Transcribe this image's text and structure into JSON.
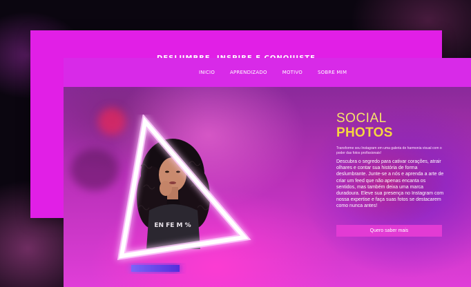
{
  "back_card": {
    "title": "DESLUMBRE, INSPIRE E CONQUISTE"
  },
  "nav": {
    "items": [
      {
        "label": "INICIO"
      },
      {
        "label": "APRENDIZADO"
      },
      {
        "label": "MOTIVO"
      },
      {
        "label": "SOBRE MIM"
      }
    ]
  },
  "hero": {
    "kicker": "SOCIAL",
    "headline": "PHOTOS",
    "small_text": "Transforme seu Instagram em uma galeria de harmonia visual com o poder das fotos profissionais!",
    "body": "Descubra o segredo para cativar corações, atrair olhares e contar sua história de forma deslumbrante. Junte-se a nós e aprenda a arte de criar um feed que não apenas encanta os sentidos, mas também deixa uma marca duradoura. Eleve sua presença no Instagram com nossa expertise e faça suas fotos se destacarem como nunca antes!",
    "cta_label": "Quero saber mais",
    "shirt_text": "EN FE M %"
  },
  "colors": {
    "magenta": "#e11fe6",
    "nav_band": "#d82ae8",
    "accent_yellow": "#f7d640",
    "cta": "#e23bd4"
  }
}
